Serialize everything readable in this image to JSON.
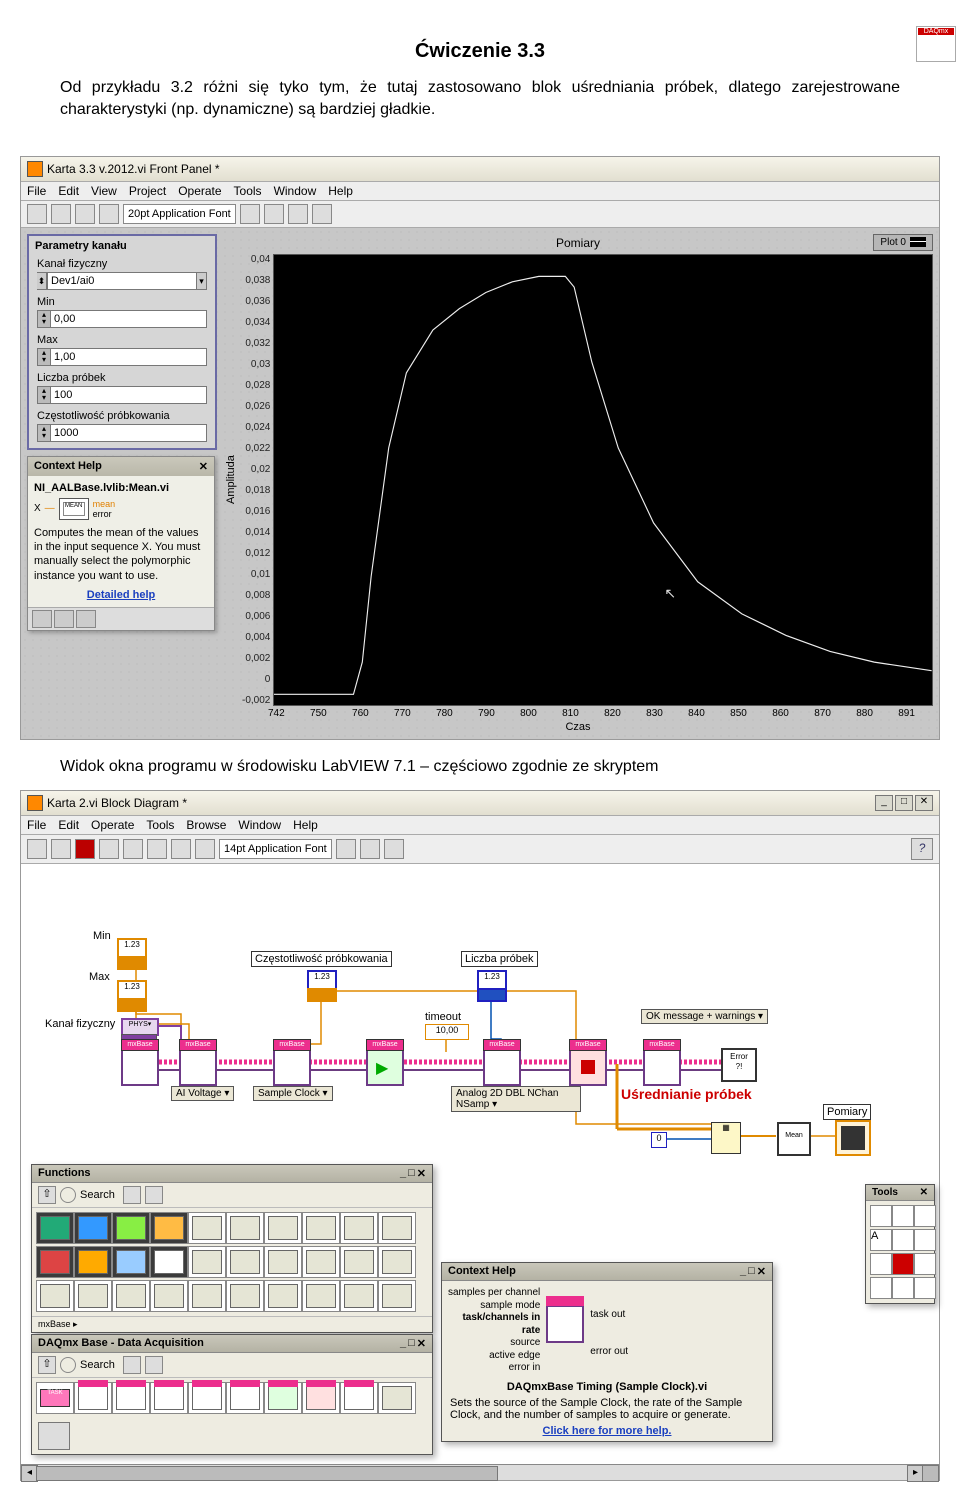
{
  "doc": {
    "title": "Ćwiczenie 3.3",
    "paragraph": "Od przykładu 3.2 różni się tyko tym, że tutaj zastosowano blok uśredniania próbek, dlatego zarejestrowane charakterystyki (np. dynamiczne) są bardziej gładkie.",
    "caption": "Widok okna programu w środowisku LabVIEW 7.1 – częściowo zgodnie ze skryptem"
  },
  "fp": {
    "window_title": "Karta 3.3 v.2012.vi Front Panel *",
    "menu": [
      "File",
      "Edit",
      "View",
      "Project",
      "Operate",
      "Tools",
      "Window",
      "Help"
    ],
    "font": "20pt Application Font",
    "panel_title": "Parametry kanału",
    "channel_label": "Kanał fizyczny",
    "channel_value": "Dev1/ai0",
    "min_label": "Min",
    "min_value": "0,00",
    "max_label": "Max",
    "max_value": "1,00",
    "nsamp_label": "Liczba próbek",
    "nsamp_value": "100",
    "rate_label": "Częstotliwość próbkowania",
    "rate_value": "1000",
    "ctx_title": "Context Help",
    "ctx_vi": "NI_AALBase.lvlib:Mean.vi",
    "ctx_x": "X",
    "ctx_mean": "mean",
    "ctx_error": "error",
    "ctx_desc": "Computes the mean of the values in the input sequence X. You must manually select the polymorphic instance you want to use.",
    "ctx_link": "Detailed help"
  },
  "chart_data": {
    "type": "line",
    "title": "Pomiary",
    "xlabel": "Czas",
    "ylabel": "Amplituda",
    "legend": "Plot 0",
    "x_ticks": [
      "742",
      "750",
      "760",
      "770",
      "780",
      "790",
      "800",
      "810",
      "820",
      "830",
      "840",
      "850",
      "860",
      "870",
      "880",
      "891"
    ],
    "y_ticks": [
      "0,04",
      "0,038",
      "0,036",
      "0,034",
      "0,032",
      "0,03",
      "0,028",
      "0,026",
      "0,024",
      "0,022",
      "0,02",
      "0,018",
      "0,016",
      "0,014",
      "0,012",
      "0,01",
      "0,008",
      "0,006",
      "0,004",
      "0,002",
      "0",
      "-0,002"
    ],
    "ylim": [
      -0.002,
      0.04
    ],
    "xlim": [
      742,
      891
    ],
    "series": [
      {
        "name": "Plot 0",
        "x": [
          742,
          755,
          760,
          762,
          764,
          768,
          772,
          778,
          784,
          790,
          796,
          802,
          806,
          808,
          810,
          814,
          820,
          828,
          838,
          848,
          858,
          868,
          878,
          891
        ],
        "values": [
          -0.001,
          -0.001,
          -0.001,
          0.002,
          0.01,
          0.022,
          0.029,
          0.033,
          0.035,
          0.0365,
          0.0375,
          0.038,
          0.038,
          0.038,
          0.037,
          0.03,
          0.022,
          0.015,
          0.0095,
          0.0065,
          0.0045,
          0.003,
          0.002,
          0.0012
        ]
      }
    ]
  },
  "bd": {
    "window_title": "Karta 2.vi Block Diagram *",
    "menu": [
      "File",
      "Edit",
      "Operate",
      "Tools",
      "Browse",
      "Window",
      "Help"
    ],
    "font": "14pt Application Font",
    "min": "Min",
    "max": "Max",
    "channel": "Kanał fizyczny",
    "rate": "Częstotliwość próbkowania",
    "nsamp": "Liczba próbek",
    "timeout_lbl": "timeout",
    "timeout_val": "10,00",
    "ai_voltage": "AI Voltage",
    "sample_clock": "Sample Clock",
    "analog2d": "Analog 2D DBL NChan NSamp",
    "okmsg": "OK message + warnings",
    "avg_label": "Uśrednianie próbek",
    "pomiary": "Pomiary",
    "zero": "0",
    "mean": "Mean",
    "functions": "Functions",
    "daqmx_base": "DAQmx Base - Data Acquisition",
    "search": "Search",
    "task_lbl": "TASK",
    "ctx2_title": "Context Help",
    "ctx2_terms": [
      "samples per channel",
      "sample mode",
      "task/channels in",
      "rate",
      "source",
      "active edge",
      "error in"
    ],
    "ctx2_right": [
      "task out",
      "error out"
    ],
    "ctx2_vi": "DAQmxBase Timing (Sample Clock).vi",
    "ctx2_desc": "Sets the source of the Sample Clock, the rate of the Sample Clock, and the number of samples to acquire or generate.",
    "ctx2_link": "Click here for more help.",
    "tools": "Tools"
  }
}
